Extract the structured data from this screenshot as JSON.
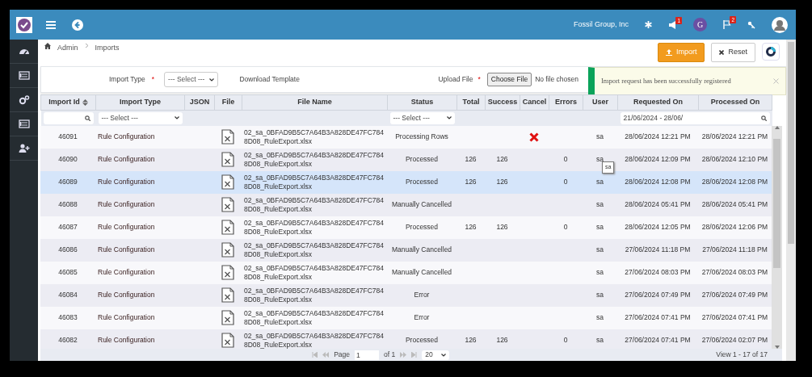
{
  "topbar": {
    "company": "Fossil Group, Inc",
    "notification_count": "1",
    "avatar_letter": "G",
    "flag_count": "2"
  },
  "breadcrumb": [
    "Admin",
    "Imports"
  ],
  "actions": [
    {
      "kind": "import",
      "label": "Import"
    },
    {
      "kind": "reset",
      "label": "Reset"
    }
  ],
  "form": [
    {
      "kind": "select",
      "label": "Import Type",
      "required_mark": "*",
      "value": "--- Select ---"
    },
    {
      "kind": "link",
      "label": "Download Template"
    },
    {
      "kind": "file",
      "label": "Upload File",
      "required_mark": "*",
      "button": "Choose File",
      "value": "No file chosen"
    }
  ],
  "toast": {
    "kind": "success",
    "message": "Import request has been successfully registered"
  },
  "table": {
    "columns": [
      {
        "label": "Import Id",
        "sortable": true
      },
      {
        "label": "Import Type",
        "sortable": false
      },
      {
        "label": "JSON",
        "sortable": false
      },
      {
        "label": "File",
        "sortable": false
      },
      {
        "label": "File Name",
        "sortable": false
      },
      {
        "label": "Status",
        "sortable": false
      },
      {
        "label": "Total",
        "sortable": false
      },
      {
        "label": "Success",
        "sortable": false
      },
      {
        "label": "Cancel",
        "sortable": false
      },
      {
        "label": "Errors",
        "sortable": false
      },
      {
        "label": "User",
        "sortable": false
      },
      {
        "label": "Requested On",
        "sortable": false
      },
      {
        "label": "Processed On",
        "sortable": false
      }
    ],
    "filters": {
      "import_type": "--- Select ---",
      "status": "--- Select ---",
      "requested_on": "21/06/2024 - 28/06/"
    },
    "rows": [
      {
        "id": "46091",
        "type": "Rule Configuration",
        "file_name": "02_sa_0BFAD9B5C7A64B3A828DE47FC7848D08_RuleExport.xlsx",
        "status": "Processing Rows",
        "cancel": true,
        "user": "sa",
        "requested_on": "28/06/2024 12:21 PM",
        "processed_on": "28/06/2024 12:21 PM",
        "selected": false
      },
      {
        "id": "46090",
        "type": "Rule Configuration",
        "file_name": "02_sa_0BFAD9B5C7A64B3A828DE47FC7848D08_RuleExport.xlsx",
        "status": "Processed",
        "total": "126",
        "success": "126",
        "cancel": false,
        "errors": "0",
        "user": "sa",
        "requested_on": "28/06/2024 12:09 PM",
        "processed_on": "28/06/2024 12:10 PM",
        "selected": false
      },
      {
        "id": "46089",
        "type": "Rule Configuration",
        "file_name": "02_sa_0BFAD9B5C7A64B3A828DE47FC7848D08_RuleExport.xlsx",
        "status": "Processed",
        "total": "126",
        "success": "126",
        "cancel": false,
        "errors": "0",
        "user": "sa",
        "requested_on": "28/06/2024 12:08 PM",
        "processed_on": "28/06/2024 12:08 PM",
        "selected": true
      },
      {
        "id": "46088",
        "type": "Rule Configuration",
        "file_name": "02_sa_0BFAD9B5C7A64B3A828DE47FC7848D08_RuleExport.xlsx",
        "status": "Manually Cancelled",
        "cancel": false,
        "user": "sa",
        "requested_on": "28/06/2024 05:41 PM",
        "processed_on": "28/06/2024 05:41 PM",
        "selected": false
      },
      {
        "id": "46087",
        "type": "Rule Configuration",
        "file_name": "02_sa_0BFAD9B5C7A64B3A828DE47FC7848D08_RuleExport.xlsx",
        "status": "Processed",
        "total": "126",
        "success": "126",
        "cancel": false,
        "errors": "0",
        "user": "sa",
        "requested_on": "28/06/2024 12:05 PM",
        "processed_on": "28/06/2024 12:06 PM",
        "selected": false
      },
      {
        "id": "46086",
        "type": "Rule Configuration",
        "file_name": "02_sa_0BFAD9B5C7A64B3A828DE47FC7848D08_RuleExport.xlsx",
        "status": "Manually Cancelled",
        "cancel": false,
        "user": "sa",
        "requested_on": "27/06/2024 11:18 PM",
        "processed_on": "27/06/2024 11:18 PM",
        "selected": false
      },
      {
        "id": "46085",
        "type": "Rule Configuration",
        "file_name": "02_sa_0BFAD9B5C7A64B3A828DE47FC7848D08_RuleExport.xlsx",
        "status": "Manually Cancelled",
        "cancel": false,
        "user": "sa",
        "requested_on": "27/06/2024 08:03 PM",
        "processed_on": "27/06/2024 08:03 PM",
        "selected": false
      },
      {
        "id": "46084",
        "type": "Rule Configuration",
        "file_name": "02_sa_0BFAD9B5C7A64B3A828DE47FC7848D08_RuleExport.xlsx",
        "status": "Error",
        "cancel": false,
        "user": "sa",
        "requested_on": "27/06/2024 07:49 PM",
        "processed_on": "27/06/2024 07:49 PM",
        "selected": false
      },
      {
        "id": "46083",
        "type": "Rule Configuration",
        "file_name": "02_sa_0BFAD9B5C7A64B3A828DE47FC7848D08_RuleExport.xlsx",
        "status": "Error",
        "cancel": false,
        "user": "sa",
        "requested_on": "27/06/2024 07:41 PM",
        "processed_on": "27/06/2024 07:41 PM",
        "selected": false
      },
      {
        "id": "46082",
        "type": "Rule Configuration",
        "file_name": "02_sa_0BFAD9B5C7A64B3A828DE47FC7848D08_RuleExport.xlsx",
        "status": "Processed",
        "total": "126",
        "success": "126",
        "cancel": false,
        "errors": "0",
        "user": "sa",
        "requested_on": "27/06/2024 07:41 PM",
        "processed_on": "27/06/2024 02:07 PM",
        "selected": false
      }
    ]
  },
  "tooltip": {
    "text": "sa"
  },
  "pager": {
    "page_label": "Page",
    "page": "1",
    "of": "of 1",
    "page_size": "20",
    "summary": "View 1 - 17 of 17"
  }
}
